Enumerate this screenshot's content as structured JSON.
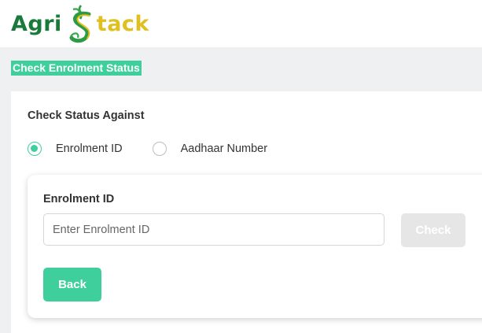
{
  "header": {
    "logo_text_left": "Agri",
    "logo_text_right": "tack",
    "logo_mark": "stylized-S-leaf",
    "colors": {
      "agri_green": "#1a7a3a",
      "stack_yellow": "#e0c020"
    }
  },
  "page": {
    "title": "Check Enrolment Status",
    "accent": "#3ecf9c"
  },
  "form": {
    "section_label": "Check Status Against",
    "options": [
      {
        "label": "Enrolment ID",
        "selected": true
      },
      {
        "label": "Aadhaar Number",
        "selected": false
      }
    ],
    "field_label": "Enrolment ID",
    "input_placeholder": "Enter Enrolment ID",
    "input_value": "",
    "check_label": "Check",
    "check_enabled": false,
    "back_label": "Back"
  }
}
